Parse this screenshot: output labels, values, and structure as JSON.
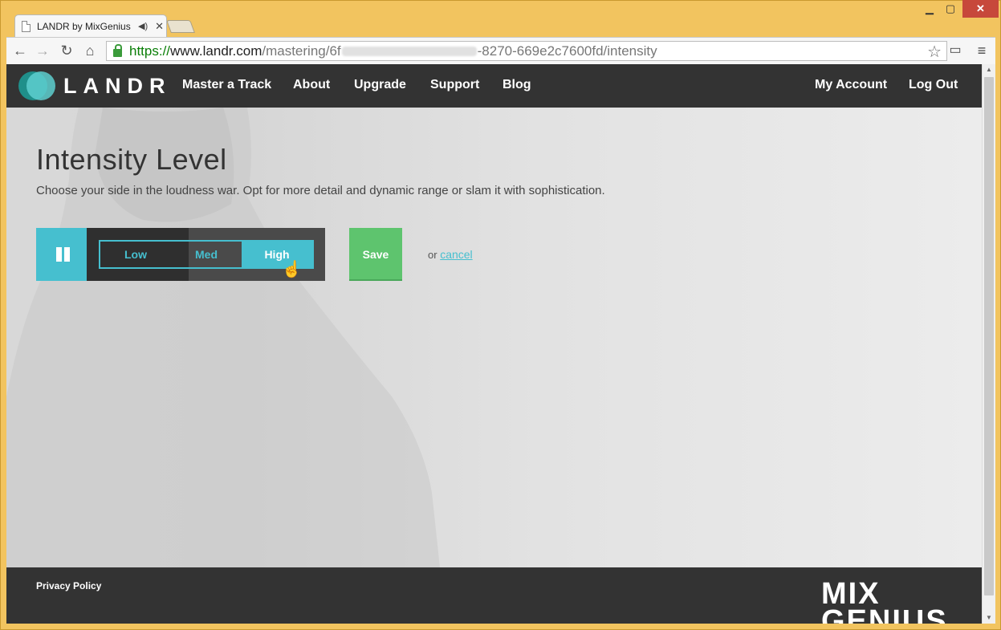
{
  "browser": {
    "tab_title": "LANDR by MixGenius",
    "url": {
      "scheme": "https://",
      "host": "www.landr.com",
      "path_start": "/mastering/6f",
      "path_end": "-8270-669e2c7600fd/intensity"
    }
  },
  "site": {
    "logo_text": "LANDR",
    "nav": {
      "master": "Master a Track",
      "about": "About",
      "upgrade": "Upgrade",
      "support": "Support",
      "blog": "Blog",
      "account": "My Account",
      "logout": "Log Out"
    }
  },
  "main": {
    "title": "Intensity Level",
    "subtitle": "Choose your side in the loudness war. Opt for more detail and dynamic range or slam it with sophistication.",
    "intensity_options": [
      "Low",
      "Med",
      "High"
    ],
    "selected_option": "High",
    "save_label": "Save",
    "or_text": "or",
    "cancel_label": "cancel"
  },
  "footer": {
    "privacy": "Privacy Policy",
    "brand_line1": "MIX",
    "brand_line2": "GENIUS"
  },
  "colors": {
    "accent": "#46bfcf",
    "save": "#5ec46e",
    "nav_bg": "#333333"
  }
}
